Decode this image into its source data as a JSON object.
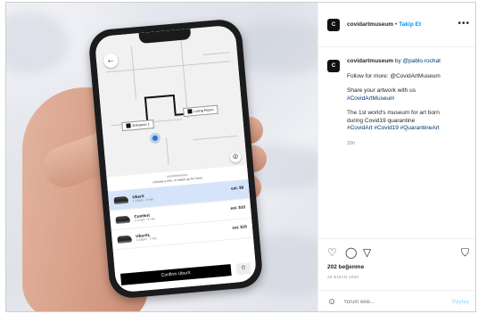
{
  "phone_app": {
    "pin_left": "Entrance 1",
    "pin_right": "Living Room",
    "sheet_title": "Choose a ride, or swipe up for more",
    "rides": [
      {
        "name": "UberX",
        "sub": "1:15pm · 4 min",
        "price": "est. $8",
        "selected": true
      },
      {
        "name": "Comfort",
        "sub": "1:17pm · 6 min",
        "price": "est. $10",
        "selected": false
      },
      {
        "name": "UberXL",
        "sub": "1:18pm · 7 min",
        "price": "est. $15",
        "selected": false
      }
    ],
    "book_button": "Confirm UberX",
    "back_icon": "←",
    "schedule_icon": "⏱"
  },
  "post": {
    "username": "covidartmuseum",
    "avatar_text": "C",
    "separator": "•",
    "follow": "Takip Et",
    "more": "•••",
    "caption_user": "covidartmuseum",
    "caption_by": "by @pablo.rochat",
    "line1": "Follow for more: @CovidArtMuseum",
    "line2a": "Share your artwork with us",
    "line2b": "#CovidArtMuseum",
    "line3a": "The 1st world's museum for art born",
    "line3b": "during Covid19 quarantine",
    "line3c": "#CovidArt #Covid19 #QuarantineArt",
    "time": "33h",
    "likes": "202 beğenme",
    "date": "20 NİSAN 2020",
    "comment_placeholder": "Yorum ekle...",
    "post_button": "Paylaş"
  },
  "colors": {
    "follow": "#0095f6",
    "selected_ride": "#d6e4fb",
    "location_dot": "#2f6fd6"
  }
}
